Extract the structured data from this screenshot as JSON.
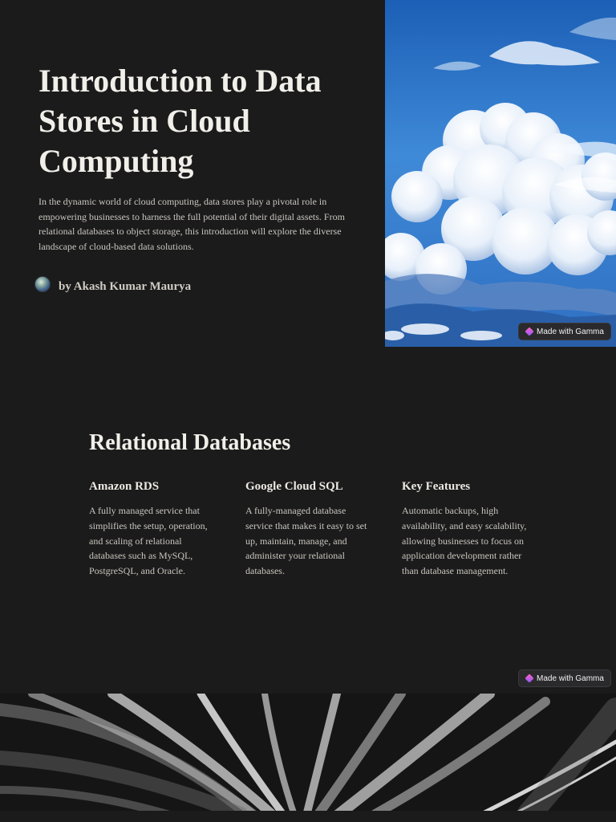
{
  "slide1": {
    "title": "Introduction to Data Stores in Cloud Computing",
    "body": " In the dynamic world of cloud computing, data stores play a pivotal role in empowering businesses to harness the full potential of their digital assets. From relational databases to object storage, this introduction will explore the diverse landscape of cloud-based data solutions.",
    "author": "by Akash Kumar Maurya",
    "badge": "Made with Gamma"
  },
  "slide2": {
    "title": "Relational Databases",
    "columns": [
      {
        "heading": "Amazon RDS",
        "text": "A fully managed service that simplifies the setup, operation, and scaling of relational databases such as MySQL, PostgreSQL, and Oracle."
      },
      {
        "heading": "Google Cloud SQL",
        "text": "A fully-managed database service that makes it easy to set up, maintain, manage, and administer your relational databases."
      },
      {
        "heading": "Key Features",
        "text": "Automatic backups, high availability, and easy scalability, allowing businesses to focus on application development rather than database management."
      }
    ],
    "badge": "Made with Gamma"
  },
  "colors": {
    "background": "#1b1b1b",
    "heading": "#f1efe9",
    "body_text": "#c9c6bf",
    "sky": "#2f76c9"
  },
  "icons": {
    "avatar": "author-avatar",
    "badge_logo": "gamma-logo-icon"
  }
}
